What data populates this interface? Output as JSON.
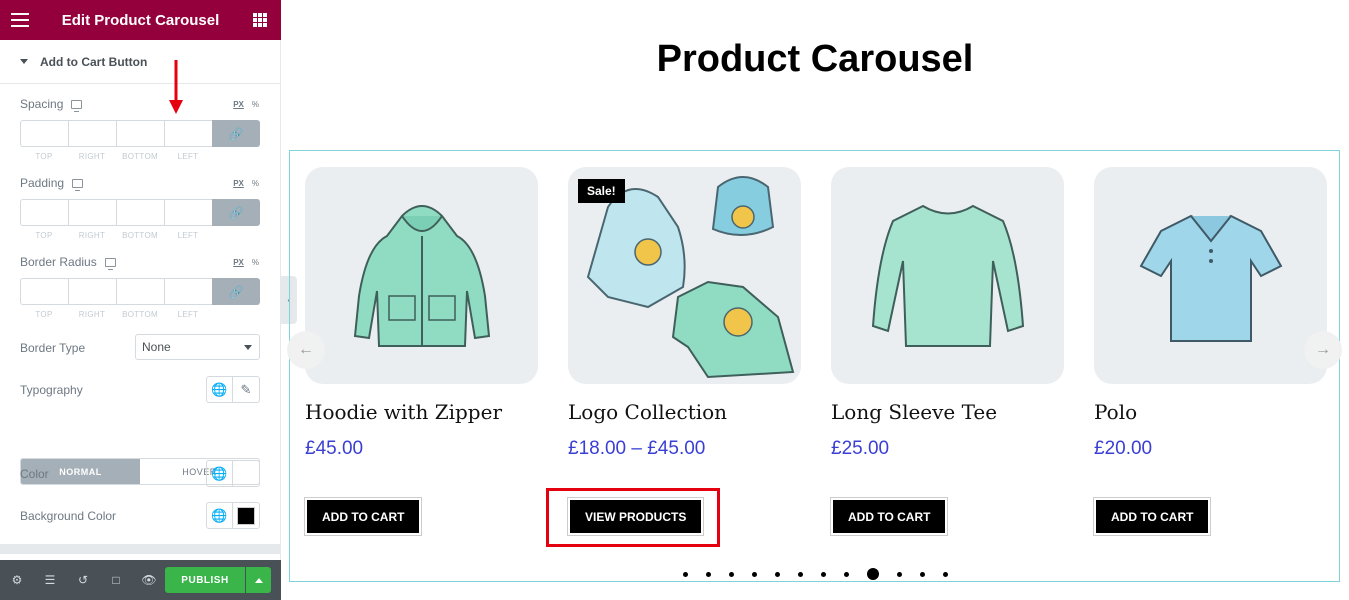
{
  "sidebar": {
    "title": "Edit Product Carousel",
    "section": "Add to Cart Button",
    "units_px": "PX",
    "units_pct": "%",
    "dim_labels": [
      "TOP",
      "RIGHT",
      "BOTTOM",
      "LEFT"
    ],
    "spacing_label": "Spacing",
    "padding_label": "Padding",
    "border_radius_label": "Border Radius",
    "border_type_label": "Border Type",
    "border_type_value": "None",
    "typography_label": "Typography",
    "tab_normal": "NORMAL",
    "tab_hover": "HOVER",
    "color_label": "Color",
    "bg_color_label": "Background Color",
    "publish_label": "PUBLISH"
  },
  "preview": {
    "title": "Product Carousel",
    "products": [
      {
        "name": "Hoodie with Zipper",
        "price": "£45.00",
        "button": "ADD TO CART"
      },
      {
        "name": "Logo Collection",
        "price": "£18.00 – £45.00",
        "button": "VIEW PRODUCTS",
        "badge": "Sale!"
      },
      {
        "name": "Long Sleeve Tee",
        "price": "£25.00",
        "button": "ADD TO CART"
      },
      {
        "name": "Polo",
        "price": "£20.00",
        "button": "ADD TO CART"
      }
    ],
    "dots_total": 12,
    "dot_active_index": 8
  },
  "colors": {
    "header": "#93003c",
    "price": "#3a3fd4",
    "publish": "#39b54a",
    "highlight": "#e5000f"
  }
}
